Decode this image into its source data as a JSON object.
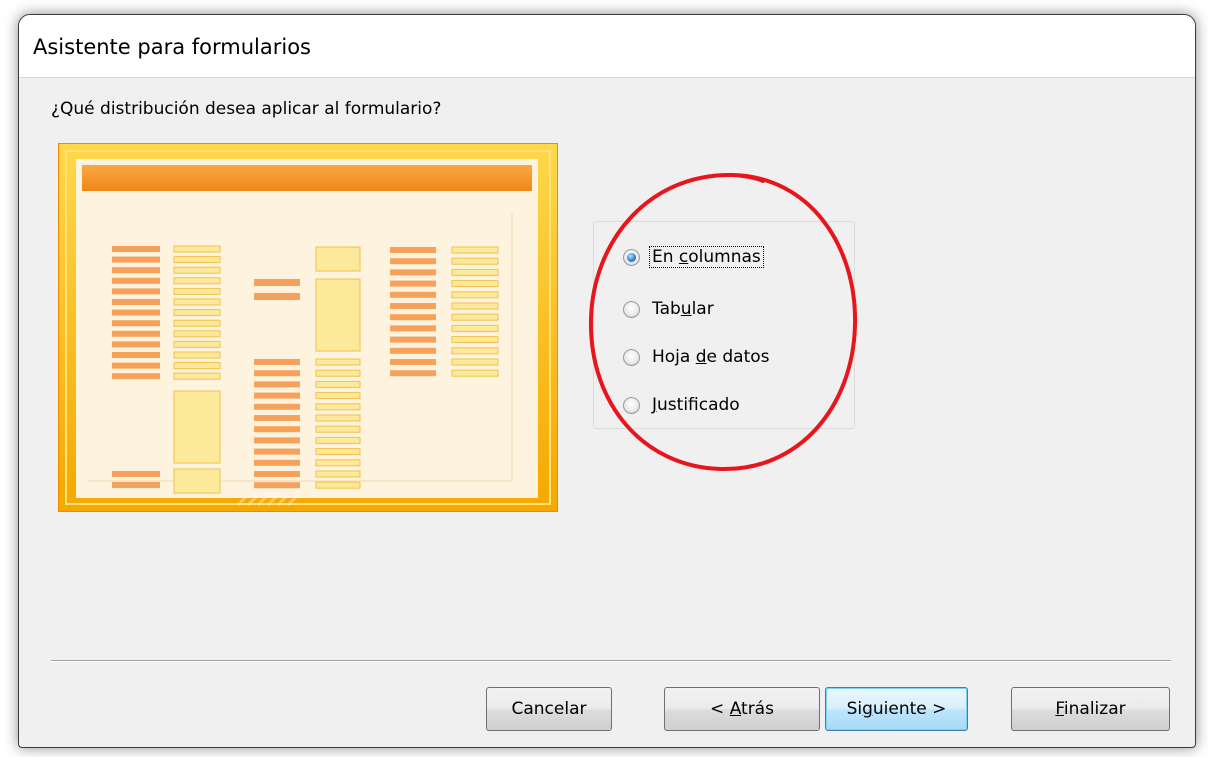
{
  "window": {
    "title": "Asistente para formularios"
  },
  "wizard": {
    "question": "¿Qué distribución desea aplicar al formulario?",
    "layout_options": [
      {
        "label": "En columnas",
        "mnemonic": "c",
        "selected": true
      },
      {
        "label": "Tabular",
        "mnemonic": "u",
        "selected": false
      },
      {
        "label": "Hoja de datos",
        "mnemonic": "d",
        "selected": false
      },
      {
        "label": "Justificado",
        "mnemonic": "J",
        "selected": false
      }
    ]
  },
  "buttons": {
    "cancel": "Cancelar",
    "back": "< Atrás",
    "next": "Siguiente >",
    "finish": "Finalizar"
  },
  "colors": {
    "preview_border": "#f9b800",
    "preview_header": "#f29421",
    "preview_label": "#f6a25a",
    "preview_field": "#fde99a",
    "annotation_circle": "#e8151c",
    "radio_selected": "#2f83d3"
  },
  "icons": {
    "layout_preview": "columnar-form-preview",
    "annotation": "red-hand-drawn-circle"
  }
}
